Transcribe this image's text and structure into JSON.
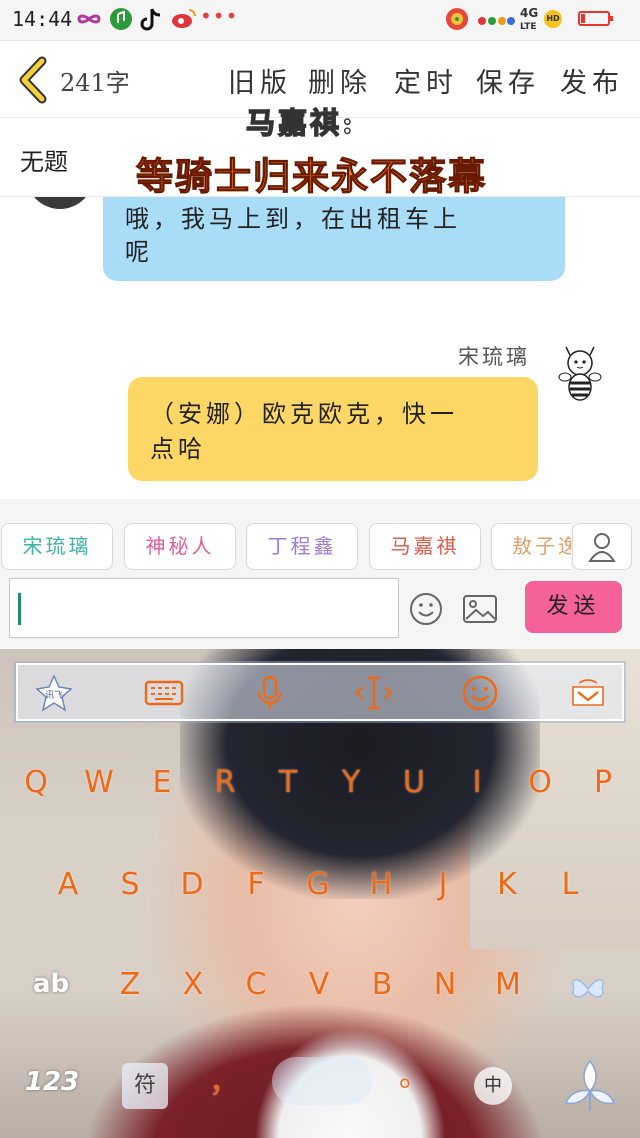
{
  "status_bar": {
    "time": "14:44",
    "dots": "•••",
    "network": "4G",
    "network_sub": "LTE",
    "hd": "HD",
    "battery_level": 0.15
  },
  "app_header": {
    "back_icon": "chevron-left-icon",
    "word_count": "241字",
    "actions": [
      "旧版",
      "删除",
      "定时",
      "保存",
      "发布"
    ]
  },
  "document": {
    "title": "无题"
  },
  "overlay": {
    "name": "马嘉祺:",
    "headline": "等骑士归来永不落幕"
  },
  "chat": {
    "messages": [
      {
        "side": "left",
        "text_line1": "哦，我马上到，在出租车上",
        "text_line2": "呢",
        "bubble_color": "#a9dcf6"
      },
      {
        "side": "right",
        "sender": "宋琉璃",
        "text_line1": "（安娜）欧克欧克，快一",
        "text_line2": "点哈",
        "bubble_color": "#fdd766"
      }
    ]
  },
  "characters": [
    {
      "name": "宋琉璃",
      "color": "#3fb3a3"
    },
    {
      "name": "神秘人",
      "color": "#e0609a"
    },
    {
      "name": "丁程鑫",
      "color": "#a07ad8"
    },
    {
      "name": "马嘉祺",
      "color": "#e05a48"
    },
    {
      "name": "敖子逸",
      "color": "#e0a070"
    }
  ],
  "composer": {
    "input_value": "",
    "send_label": "发送",
    "send_color": "#f5629a"
  },
  "keyboard": {
    "row1": [
      "Q",
      "W",
      "E",
      "R",
      "T",
      "Y",
      "U",
      "I",
      "O",
      "P"
    ],
    "row2": [
      "A",
      "S",
      "D",
      "F",
      "G",
      "H",
      "J",
      "K",
      "L"
    ],
    "row3": [
      "Z",
      "X",
      "C",
      "V",
      "B",
      "N",
      "M"
    ],
    "shift_label": "ab",
    "numbers_label": "123",
    "symbols_label": "符",
    "comma_label": "，",
    "period_label": "。",
    "lang_label": "中",
    "key_color": "#ee6a18"
  }
}
